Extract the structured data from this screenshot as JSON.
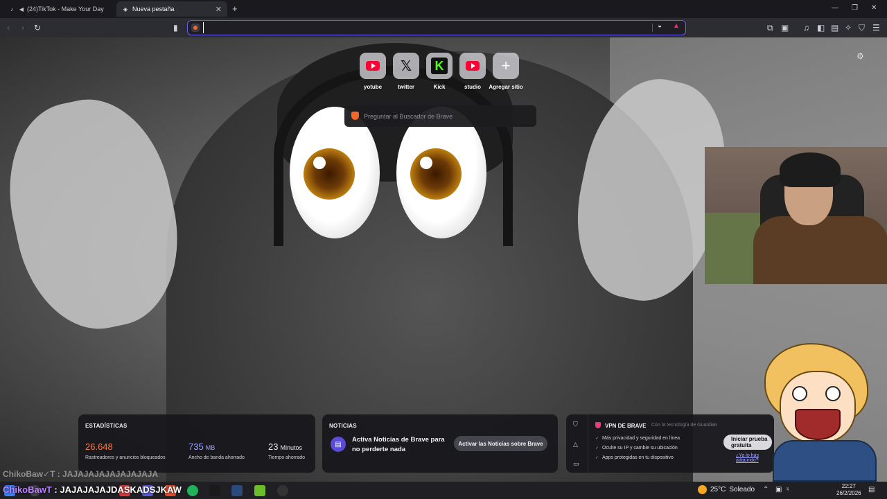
{
  "browser": {
    "tabs": [
      {
        "label": "(24)TikTok - Make Your Day",
        "active": false
      },
      {
        "label": "Nueva pestaña",
        "active": true
      }
    ],
    "new_tab_symbol": "+",
    "window_controls": {
      "minimize": "—",
      "restore": "❐",
      "close": "✕"
    },
    "url_value": ""
  },
  "new_tab_page": {
    "shortcuts": [
      {
        "label": "yotube",
        "icon": "youtube-icon"
      },
      {
        "label": "twitter",
        "icon": "x-icon"
      },
      {
        "label": "Kick",
        "icon": "kick-icon"
      },
      {
        "label": "studio",
        "icon": "youtube-icon"
      },
      {
        "label": "Agregar sitio",
        "icon": "plus-icon"
      }
    ],
    "search_placeholder": "Preguntar al Buscador de Brave",
    "stats": {
      "title": "ESTADÍSTICAS",
      "trackers": {
        "value": "26.648",
        "desc": "Rastreadores y anuncios bloqueados",
        "color": "#ff7a45"
      },
      "bandwidth": {
        "value": "735",
        "unit": "MB",
        "desc": "Ancho de banda ahorrado",
        "color": "#9fa6ff"
      },
      "time": {
        "value": "23",
        "unit": "Minutos",
        "desc": "Tiempo ahorrado",
        "color": "#ffffff"
      }
    },
    "news": {
      "title": "NOTICIAS",
      "text": "Activa Noticias de Brave para no perderte nada",
      "button": "Activar las Noticias sobre Brave"
    },
    "vpn": {
      "title": "VPN DE BRAVE",
      "powered_by": "Con la tecnología de Guardian",
      "features": [
        "Más privacidad y seguridad en línea",
        "Oculte su IP y cambie su ubicación",
        "Apps protegidas en tu dispositivo"
      ],
      "button": "Iniciar prueba gratuita",
      "link": "¿Ya lo has adquirido?"
    }
  },
  "overlay": {
    "chat_previous": "ChikoBaw✓T : JAJAJAJAJAJAJAJAJA",
    "chat_user": "ChikoBawT",
    "chat_message": " : JAJAJAJAJDASKADSJKAW"
  },
  "taskbar": {
    "weather": {
      "temp": "25°C",
      "condition": "Soleado"
    },
    "time": "22:27",
    "date": "26/2/2026"
  }
}
